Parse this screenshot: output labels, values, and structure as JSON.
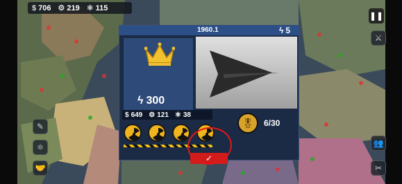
{
  "resources": {
    "money": "706",
    "industry": "219",
    "tech": "115"
  },
  "dialog": {
    "unit_name": "1960.1",
    "top_cost": "5",
    "big_cost": "300",
    "costs": {
      "money": "649",
      "industry": "121",
      "tech": "38"
    },
    "officer_count": "6/30",
    "confirm_icon": "✓"
  },
  "icons": {
    "money": "dollar-icon",
    "industry": "gear-icon",
    "tech": "atom-icon",
    "energy": "lightning-icon",
    "crown": "crown-icon",
    "officer": "officer-cap-icon",
    "nuclear": "nuclear-icon",
    "pause": "pause-icon"
  },
  "colors": {
    "confirm_button": "#d21c1c",
    "dialog_bg": "#1b2b45",
    "crown": "#f2c12e",
    "hazard_yellow": "#f0c21c"
  }
}
